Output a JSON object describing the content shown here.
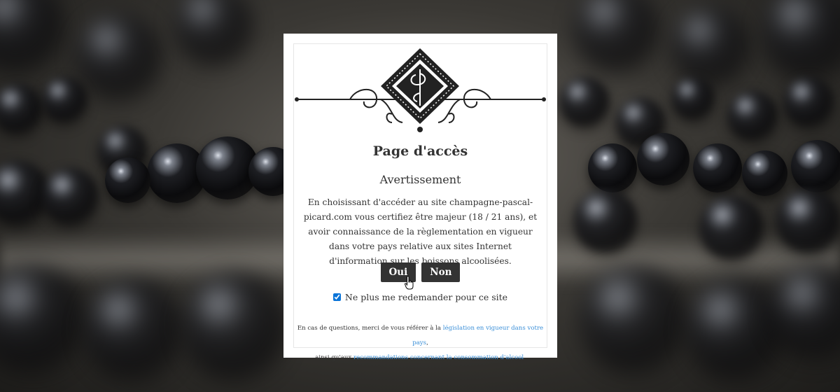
{
  "modal": {
    "title": "Page d'accès",
    "subtitle": "Avertissement",
    "body": "En choisissant d'accéder au site champagne-pascal-picard.com vous certifiez être majeur (18 / 21 ans), et avoir connaissance de la règlementation en vigueur dans votre pays relative aux sites Internet d'information sur les boissons alcoolisées.",
    "yes_label": "Oui",
    "no_label": "Non",
    "remember_label": "Ne plus me redemander pour ce site",
    "remember_checked": true,
    "footer": {
      "line1_prefix": "En cas de questions, merci de vous référer à la ",
      "link1": "législation en vigueur dans votre pays",
      "line1_suffix": ",",
      "line2_prefix": "ainsi qu'aux ",
      "link2": "recommandations concernant la consommation d'alcool",
      "line2_suffix": "."
    }
  },
  "colors": {
    "button_bg": "#333333",
    "link": "#3a8fd8",
    "text": "#333333"
  },
  "icons": {
    "logo": "ornamental-diamond-monogram-logo",
    "cursor": "hand-pointer-cursor"
  }
}
